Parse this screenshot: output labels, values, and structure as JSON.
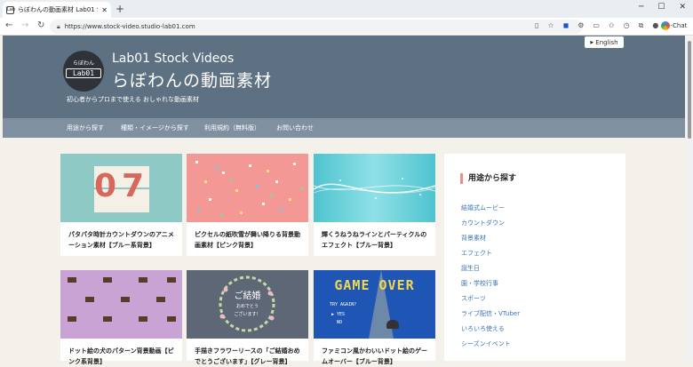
{
  "browser": {
    "tab_title": "らぼわんの動画素材 Lab01 Stock Vi",
    "tab_favicon": "Lab",
    "url": "https://www.stock-video.studio-lab01.com",
    "chat_label": "Chat"
  },
  "site": {
    "logo_line1": "らぼわん",
    "logo_line2": "Lab01",
    "name_en": "Lab01 Stock Videos",
    "name_ja": "らぼわんの動画素材",
    "tagline": "初心者からプロまで使える おしゃれな動画素材",
    "lang_switch": "English"
  },
  "menu": [
    "用途から探す",
    "種類・イメージから探す",
    "利用規約（無料版）",
    "お問い合わせ"
  ],
  "cards": [
    {
      "title": "パタパタ時計カウントダウンのアニメーション素材【ブルー系背景】",
      "digits": "07"
    },
    {
      "title": "ピクセルの紙吹雪が舞い降りる背景動画素材【ピンク背景】"
    },
    {
      "title": "輝くうねうねラインとパーティクルのエフェクト【ブルー背景】"
    },
    {
      "title": "ドット絵の犬のパターン背景動画【ピンク系背景】"
    },
    {
      "title": "手描きフラワーリースの「ご結婚おめでとうございます」【グレー背景】",
      "wreath_line1": "ご結婚",
      "wreath_line2": "おめでとう",
      "wreath_line3": "ございます！"
    },
    {
      "title": "ファミコン風かわいいドット絵のゲームオーバー【ブルー背景】",
      "game_over": "GAME OVER",
      "try_again": "TRY AGAIN?",
      "yes": "YES",
      "no": "NO"
    }
  ],
  "sidebar": {
    "heading": "用途から探す",
    "items": [
      "結婚式ムービー",
      "カウントダウン",
      "背景素材",
      "エフェクト",
      "誕生日",
      "園・学校行事",
      "スポーツ",
      "ライブ配信・VTuber",
      "いろいろ使える",
      "シーズンイベント"
    ]
  },
  "colors": {
    "header_bg": "#5e7182",
    "menu_bg": "#7f90a1",
    "page_bg": "#f4f0ea",
    "link": "#3a74b5",
    "accent": "#e4918a"
  }
}
